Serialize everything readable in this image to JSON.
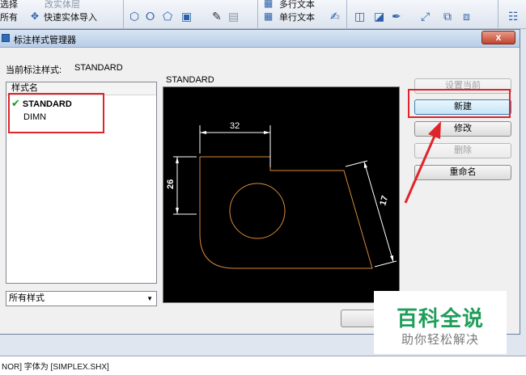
{
  "toolbar": {
    "row1_left": "选择",
    "row1_left2": "改实体层",
    "row2_left": "所有",
    "quick_import": "快速实体导入",
    "multiline_text": "多行文本",
    "single_line_text": "单行文本"
  },
  "dialog": {
    "title": "标注样式管理器",
    "close_label": "x",
    "current_style_label": "当前标注样式:",
    "current_style_value": "STANDARD",
    "list_header": "样式名",
    "styles": [
      "STANDARD",
      "DIMN"
    ],
    "preview_label": "STANDARD",
    "filter_value": "所有样式",
    "buttons": {
      "set_current": "设置当前",
      "new": "新建",
      "modify": "修改",
      "delete": "删除",
      "rename": "重命名"
    }
  },
  "preview_drawing": {
    "dim_horizontal": "32",
    "dim_vertical": "26",
    "dim_aligned": "17"
  },
  "watermark": {
    "main": "百科全说",
    "sub": "助你轻松解决"
  },
  "command_line": "NOR] 字体为 [SIMPLEX.SHX]",
  "colors": {
    "annotation": "#e0242a",
    "check": "#1a9a1a",
    "geometry": "#d98a3a",
    "watermark": "#1f9e5a"
  }
}
